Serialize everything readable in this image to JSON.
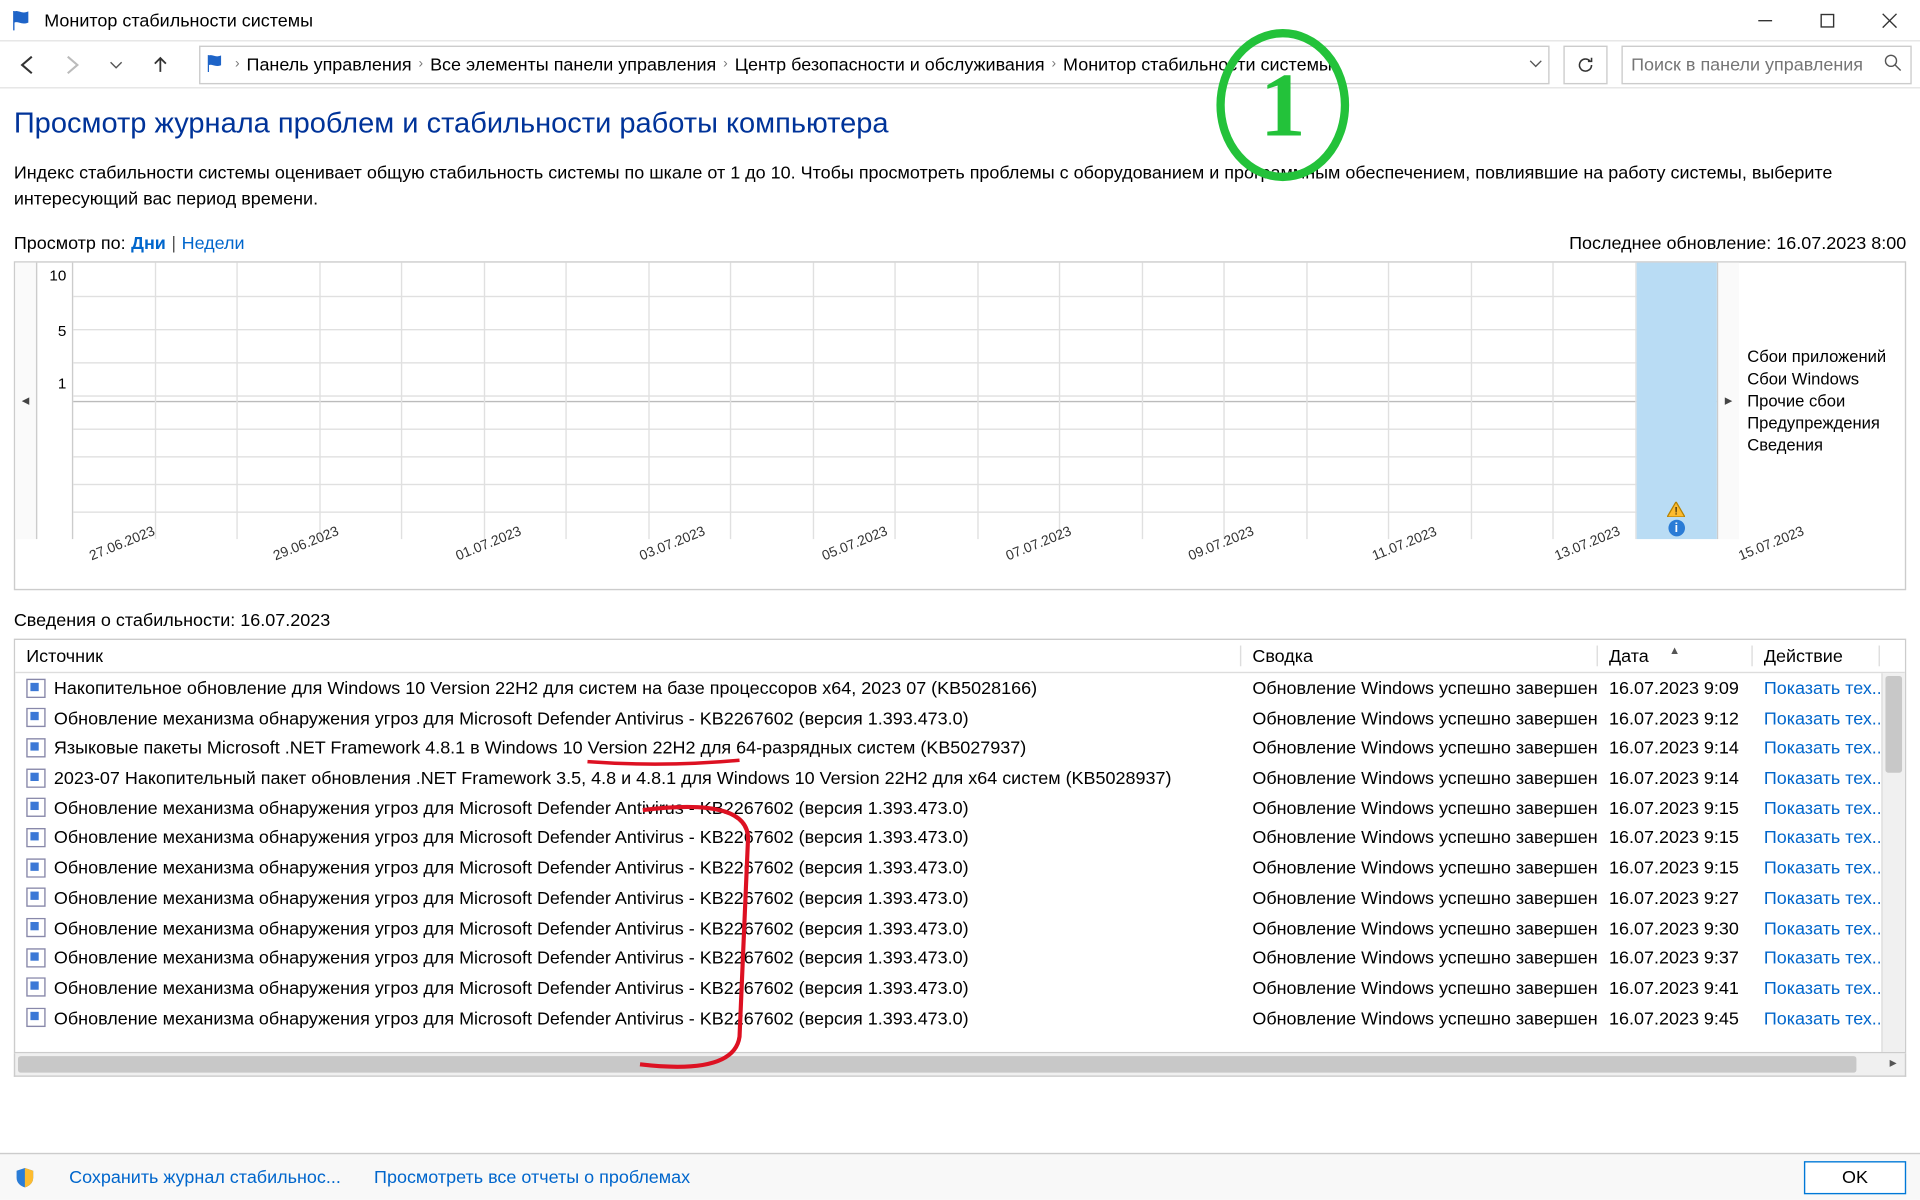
{
  "window": {
    "title": "Монитор стабильности системы"
  },
  "breadcrumbs": {
    "items": [
      "Панель управления",
      "Все элементы панели управления",
      "Центр безопасности и обслуживания",
      "Монитор стабильности системы"
    ]
  },
  "search": {
    "placeholder": "Поиск в панели управления"
  },
  "heading": "Просмотр журнала проблем и стабильности работы компьютера",
  "description": "Индекс стабильности системы оценивает общую стабильность системы по шкале от 1 до 10. Чтобы просмотреть проблемы с оборудованием и программным обеспечением, повлиявшие на работу системы, выберите интересующий вас период времени.",
  "view": {
    "label": "Просмотр по:",
    "days": "Дни",
    "weeks": "Недели",
    "last_update_label": "Последнее обновление:",
    "last_update_value": "16.07.2023 8:00"
  },
  "chart": {
    "yticks": [
      "10",
      "5",
      "1"
    ],
    "dates": [
      "27.06.2023",
      "",
      "29.06.2023",
      "",
      "01.07.2023",
      "",
      "03.07.2023",
      "",
      "05.07.2023",
      "",
      "07.07.2023",
      "",
      "09.07.2023",
      "",
      "11.07.2023",
      "",
      "13.07.2023",
      "",
      "15.07.2023",
      ""
    ],
    "legend": [
      "Сбои приложений",
      "Сбои Windows",
      "Прочие сбои",
      "Предупреждения",
      "Сведения"
    ]
  },
  "details": {
    "header_prefix": "Сведения о стабильности:",
    "header_date": "16.07.2023",
    "columns": {
      "source": "Источник",
      "summary": "Сводка",
      "date": "Дата",
      "action": "Действие"
    },
    "action_txt": "Показать тех...",
    "rows": [
      {
        "src": "Накопительное обновление для Windows 10 Version 22H2 для систем на базе процессоров x64, 2023 07 (KB5028166)",
        "sum": "Обновление Windows успешно завершено",
        "date": "16.07.2023 9:09"
      },
      {
        "src": "Обновление механизма обнаружения угроз для Microsoft Defender Antivirus - KB2267602 (версия 1.393.473.0)",
        "sum": "Обновление Windows успешно завершено",
        "date": "16.07.2023 9:12"
      },
      {
        "src": "Языковые пакеты Microsoft .NET Framework 4.8.1 в Windows 10 Version 22H2 для 64-разрядных систем (KB5027937)",
        "sum": "Обновление Windows успешно завершено",
        "date": "16.07.2023 9:14"
      },
      {
        "src": "2023-07 Накопительный пакет обновления .NET Framework 3.5, 4.8 и 4.8.1 для Windows 10 Version 22H2 для x64 систем (KB5028937)",
        "sum": "Обновление Windows успешно завершено",
        "date": "16.07.2023 9:14"
      },
      {
        "src": "Обновление механизма обнаружения угроз для Microsoft Defender Antivirus - KB2267602 (версия 1.393.473.0)",
        "sum": "Обновление Windows успешно завершено",
        "date": "16.07.2023 9:15"
      },
      {
        "src": "Обновление механизма обнаружения угроз для Microsoft Defender Antivirus - KB2267602 (версия 1.393.473.0)",
        "sum": "Обновление Windows успешно завершено",
        "date": "16.07.2023 9:15"
      },
      {
        "src": "Обновление механизма обнаружения угроз для Microsoft Defender Antivirus - KB2267602 (версия 1.393.473.0)",
        "sum": "Обновление Windows успешно завершено",
        "date": "16.07.2023 9:15"
      },
      {
        "src": "Обновление механизма обнаружения угроз для Microsoft Defender Antivirus - KB2267602 (версия 1.393.473.0)",
        "sum": "Обновление Windows успешно завершено",
        "date": "16.07.2023 9:27"
      },
      {
        "src": "Обновление механизма обнаружения угроз для Microsoft Defender Antivirus - KB2267602 (версия 1.393.473.0)",
        "sum": "Обновление Windows успешно завершено",
        "date": "16.07.2023 9:30"
      },
      {
        "src": "Обновление механизма обнаружения угроз для Microsoft Defender Antivirus - KB2267602 (версия 1.393.473.0)",
        "sum": "Обновление Windows успешно завершено",
        "date": "16.07.2023 9:37"
      },
      {
        "src": "Обновление механизма обнаружения угроз для Microsoft Defender Antivirus - KB2267602 (версия 1.393.473.0)",
        "sum": "Обновление Windows успешно завершено",
        "date": "16.07.2023 9:41"
      },
      {
        "src": "Обновление механизма обнаружения угроз для Microsoft Defender Antivirus - KB2267602 (версия 1.393.473.0)",
        "sum": "Обновление Windows успешно завершено",
        "date": "16.07.2023 9:45"
      }
    ]
  },
  "footer": {
    "save": "Сохранить журнал стабильнос...",
    "view_all": "Просмотреть все отчеты о проблемах",
    "ok": "OK"
  },
  "annotations": {
    "number": "1"
  }
}
